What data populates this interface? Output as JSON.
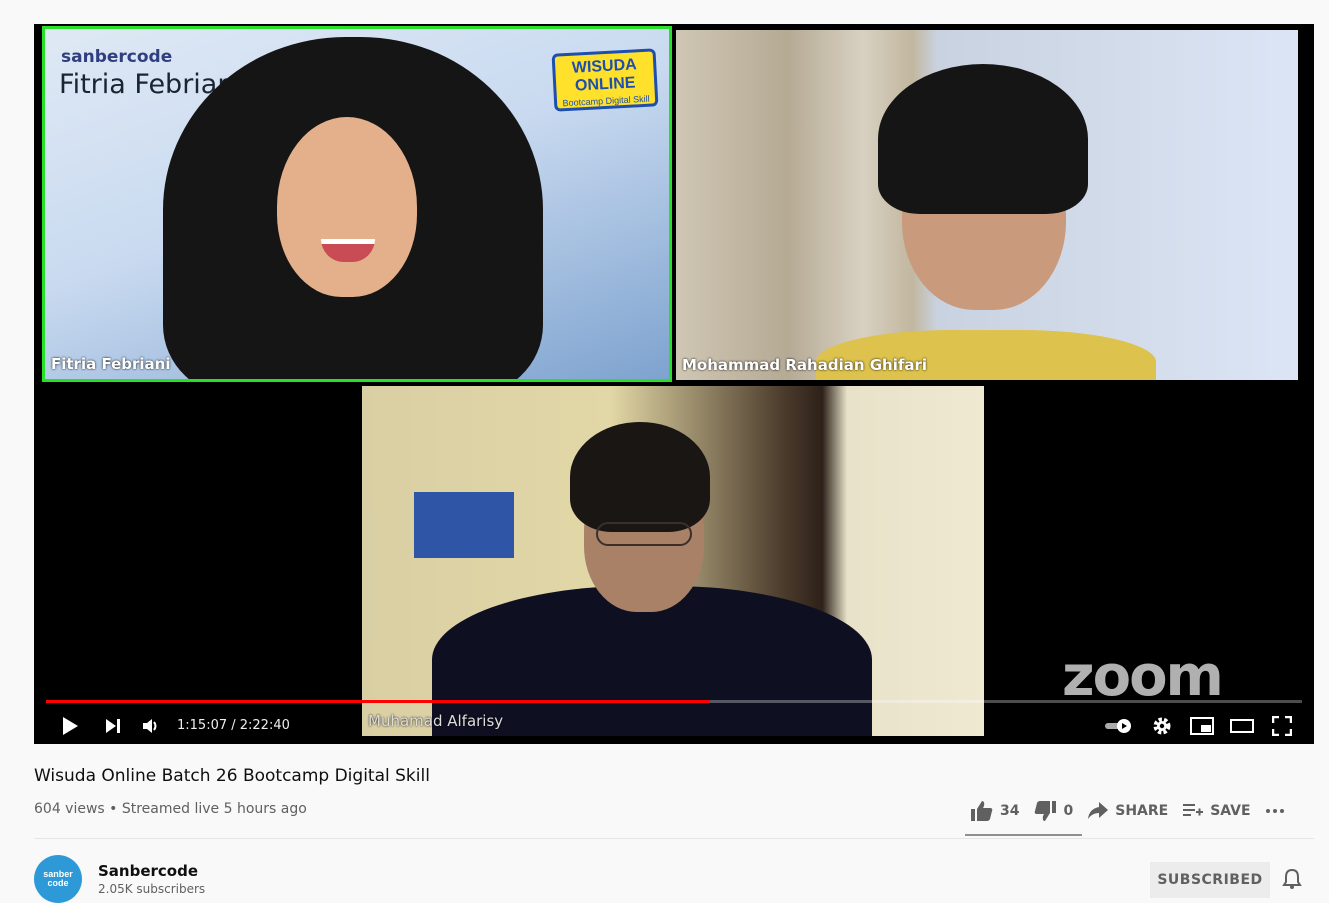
{
  "player": {
    "participants": [
      {
        "name": "Fitria Febriani"
      },
      {
        "name": "Mohammad Rahadian Ghifari"
      },
      {
        "name": "Muhamad Alfarisy"
      }
    ],
    "speaker_brand": "sanbercode",
    "speaker_card_name": "Fitria Febriani",
    "event_badge": {
      "title": "WISUDA ONLINE",
      "subtitle": "Bootcamp Digital Skill"
    },
    "watermark": "zoom",
    "time_display": "1:15:07 / 2:22:40",
    "progress_fraction": 0.529,
    "controls": [
      "play-icon",
      "next-icon",
      "volume-icon",
      "autoplay-toggle-icon",
      "settings-icon",
      "miniplayer-icon",
      "theater-icon",
      "fullscreen-icon"
    ]
  },
  "video": {
    "title": "Wisuda Online Batch 26 Bootcamp Digital Skill",
    "meta": "604 views • Streamed live 5 hours ago",
    "likes": "34",
    "dislikes": "0",
    "share_label": "SHARE",
    "save_label": "SAVE"
  },
  "channel": {
    "name": "Sanbercode",
    "subscribers": "2.05K subscribers",
    "avatar_text": "sanber code",
    "subscribe_label": "SUBSCRIBED"
  },
  "colors": {
    "accent": "#ff0000",
    "active_speaker": "#28e02a"
  }
}
